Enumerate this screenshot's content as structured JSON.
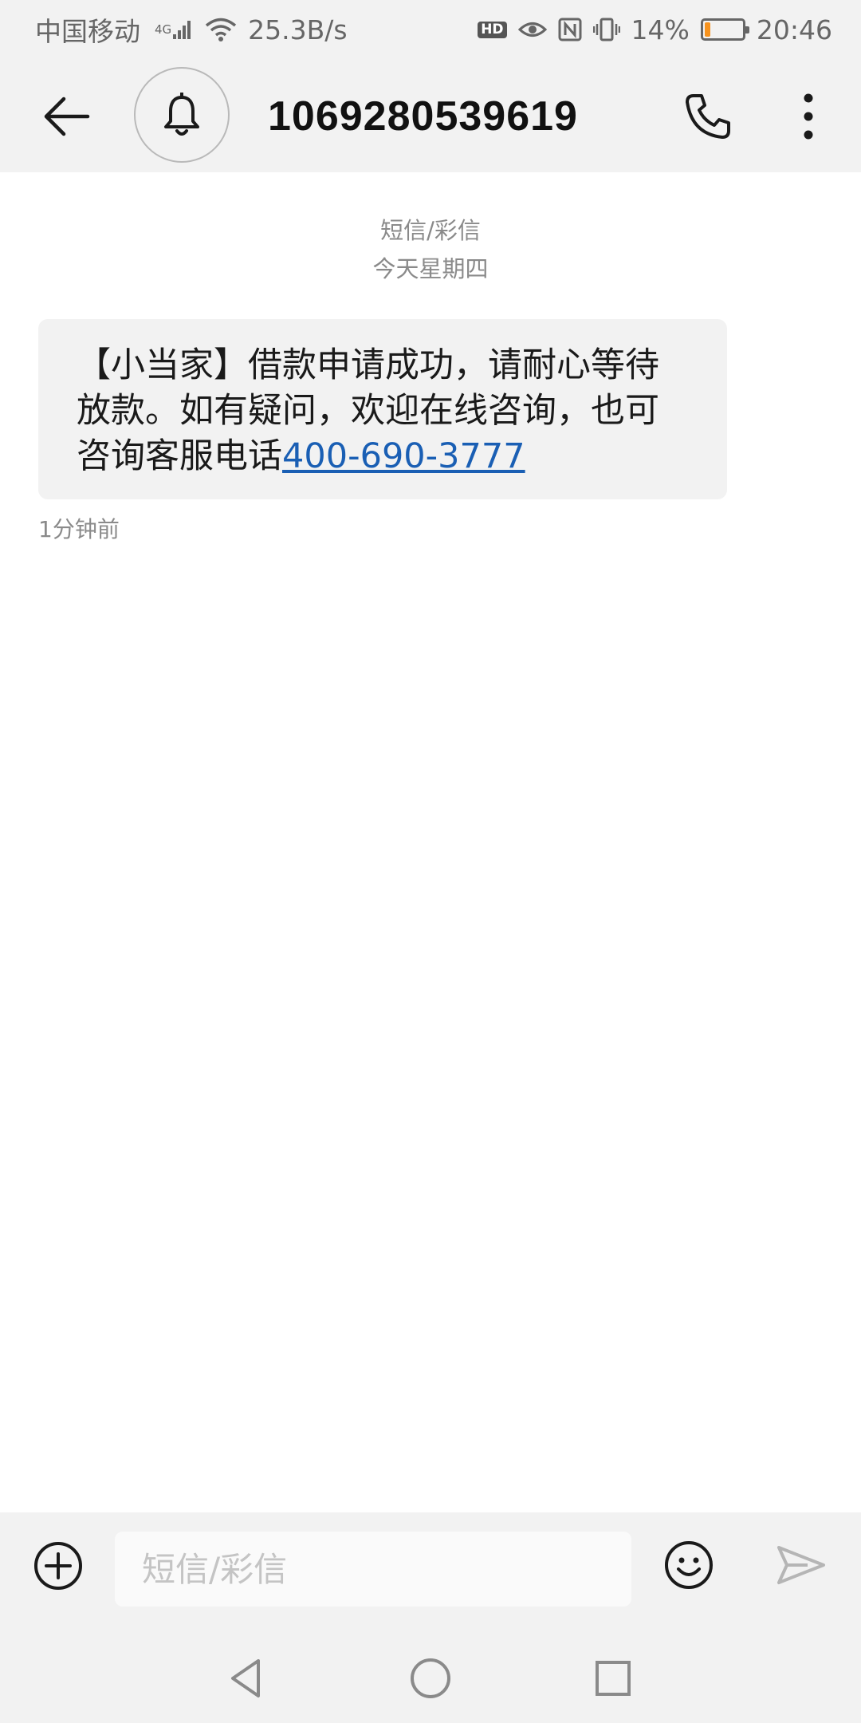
{
  "status_bar": {
    "carrier": "中国移动",
    "network": "4G",
    "speed": "25.3B/s",
    "hd_label": "HD",
    "battery_percent": "14%",
    "battery_level": 0.14,
    "time": "20:46"
  },
  "header": {
    "contact": "1069280539619"
  },
  "conversation": {
    "type_label": "短信/彩信",
    "date_label": "今天星期四",
    "messages": [
      {
        "text": "【小当家】借款申请成功，请耐心等待放款。如有疑问，欢迎在线咨询，也可咨询客服电话",
        "link": "400-690-3777",
        "time": "1分钟前"
      }
    ]
  },
  "composer": {
    "placeholder": "短信/彩信"
  },
  "colors": {
    "bar_background": "#f2f2f2",
    "bubble_background": "#f2f2f2",
    "link": "#1a5fb4",
    "battery_low": "#f7931e"
  },
  "icons": {
    "back": "arrow-left-icon",
    "notification": "bell-icon",
    "call": "phone-icon",
    "more": "more-vertical-icon",
    "attach": "plus-circle-icon",
    "emoji": "smiley-icon",
    "send": "send-icon"
  }
}
